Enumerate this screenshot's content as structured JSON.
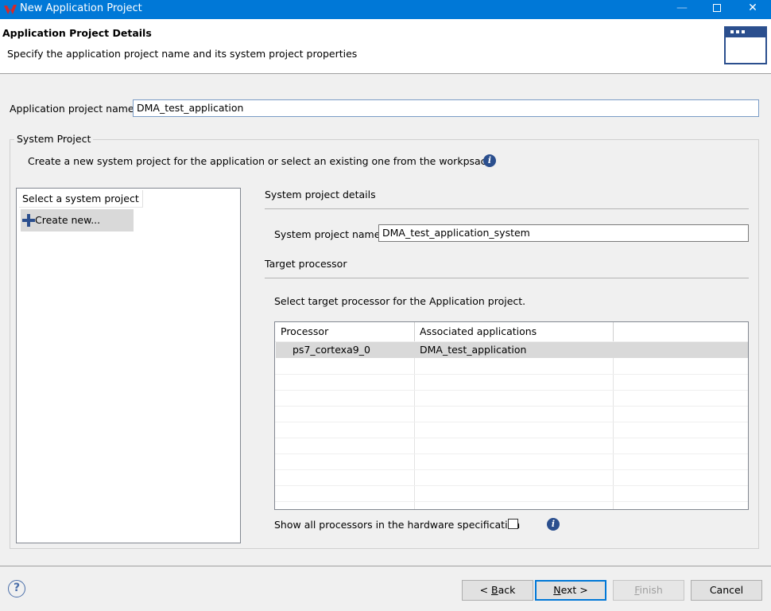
{
  "window": {
    "title": "New Application Project",
    "minimize_glyph": "—",
    "close_glyph": "✕"
  },
  "header": {
    "title": "Application Project Details",
    "description": "Specify the application project name and its system project properties"
  },
  "project_name": {
    "label": "Application project name:",
    "value": "DMA_test_application"
  },
  "system_project": {
    "group_title": "System Project",
    "description": "Create a new system project for the application or select an existing one from the workpsace",
    "info_glyph": "i",
    "list": {
      "header": "Select a system project",
      "create_label": "Create new..."
    },
    "details": {
      "section_title": "System project details",
      "name_label": "System project name:",
      "name_value": "DMA_test_application_system"
    },
    "target": {
      "section_title": "Target processor",
      "instruction": "Select target processor for the Application project.",
      "columns": [
        "Processor",
        "Associated applications"
      ],
      "rows": [
        {
          "processor": "ps7_cortexa9_0",
          "applications": "DMA_test_application"
        }
      ],
      "show_all_label": "Show all processors in the hardware specification",
      "show_all_checked": false
    }
  },
  "footer": {
    "help_glyph": "?",
    "back_prefix": "< ",
    "back_key": "B",
    "back_rest": "ack",
    "next_key": "N",
    "next_rest": "ext >",
    "finish_key": "F",
    "finish_rest": "inish",
    "cancel_label": "Cancel"
  },
  "colors": {
    "titlebar": "#0078d7",
    "selection": "#d9d9d9",
    "info_icon": "#2b4f8e"
  }
}
